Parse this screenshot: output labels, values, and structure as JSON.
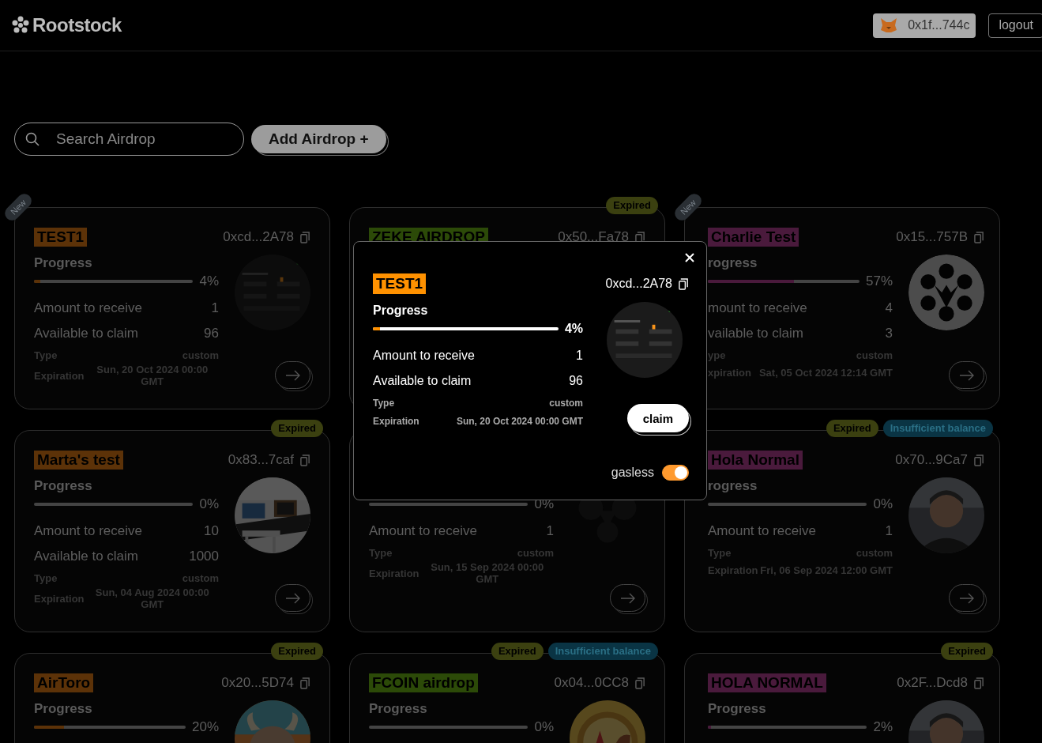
{
  "header": {
    "logo": "Rootstock",
    "wallet": "0x1f...744c",
    "logout": "logout"
  },
  "toolbar": {
    "search": {
      "placeholder": "Search Airdrop"
    },
    "add_button": "Add Airdrop +"
  },
  "cards": [
    {
      "ribbon": "New",
      "title": "TEST1",
      "color": "#5c3208",
      "address": "0xcd...2A78",
      "progress_label": "Progress",
      "level": 0.04,
      "percent": "4%",
      "rows": [
        {
          "kind": "main",
          "label": "Amount to receive",
          "value": "1"
        },
        {
          "kind": "main",
          "label": "Available to claim",
          "value": "96"
        },
        {
          "kind": "small",
          "label": "Type",
          "value": "custom"
        },
        {
          "kind": "small",
          "label": "Expiration",
          "value": "Sun, 20 Oct 2024 00:00 GMT"
        }
      ],
      "image": {
        "kind": "picture"
      },
      "open_button": true
    },
    {
      "badges": [
        {
          "text": "Expired",
          "color": "#3b4010"
        }
      ],
      "title": "ZEKE AIRDROP",
      "color": "#2c4a08",
      "address": "0x50...Fa78"
    },
    {
      "ribbon": "New",
      "title": "Charlie Test",
      "color": "#4a1a3c",
      "address": "0x15...757B",
      "progress_label": "rogress",
      "level": 0.57,
      "percent": "57%",
      "rows": [
        {
          "kind": "main",
          "label": "mount to receive",
          "value": "4"
        },
        {
          "kind": "main",
          "label": "vailable to claim",
          "value": "3"
        },
        {
          "kind": "small",
          "label": "ype",
          "value": "custom"
        },
        {
          "kind": "small",
          "label": "xpiration",
          "value": "Sat, 05 Oct 2024 12:14 GMT"
        }
      ],
      "image": {
        "kind": "logo"
      },
      "open_button": true
    },
    {
      "badges": [
        {
          "text": "Expired",
          "color": "#3b4010"
        }
      ],
      "title": "Marta's test",
      "color": "#5c3208",
      "address": "0x83...7caf",
      "progress_label": "Progress",
      "level": 0,
      "percent": "0%",
      "rows": [
        {
          "kind": "main",
          "label": "Amount to receive",
          "value": "10"
        },
        {
          "kind": "main",
          "label": "Available to claim",
          "value": "1000"
        },
        {
          "kind": "small",
          "label": "Type",
          "value": "custom"
        },
        {
          "kind": "small",
          "label": "Expiration",
          "value": "Sun, 04 Aug 2024 00:00 GMT"
        }
      ],
      "image": {
        "kind": "picture"
      },
      "open_button": true
    },
    {
      "level": 0,
      "percent": "0%",
      "rows": [
        {
          "kind": "main",
          "label": "Amount to receive",
          "value": "1"
        },
        {
          "kind": "small",
          "label": "Type",
          "value": "custom"
        },
        {
          "kind": "small",
          "label": "Expiration",
          "value": "Sun, 15 Sep 2024 00:00 GMT"
        }
      ],
      "image": {
        "kind": "mark"
      },
      "open_button": true
    },
    {
      "badges": [
        {
          "text": "Expired",
          "color": "#3b4010"
        },
        {
          "text": "Insufficient balance",
          "color": "#0a3444"
        }
      ],
      "title": "Hola Normal",
      "color": "#4a1a3c",
      "address": "0x70...9Ca7",
      "progress_label": "rogress",
      "level": 0,
      "percent": "0%",
      "rows": [
        {
          "kind": "main",
          "label": "Amount to receive",
          "value": "1"
        },
        {
          "kind": "small",
          "label": "Type",
          "value": "custom"
        },
        {
          "kind": "small",
          "label": "Expiration",
          "value": "Fri, 06 Sep 2024 12:00 GMT"
        }
      ],
      "image": {
        "kind": "picture"
      },
      "open_button": true
    },
    {
      "badges": [
        {
          "text": "Expired",
          "color": "#3b4010"
        }
      ],
      "title": "AirToro",
      "color": "#5c3208",
      "address": "0x20...5D74",
      "progress_label": "Progress",
      "level": 0.2,
      "percent": "20%",
      "image": {
        "kind": "picture"
      }
    },
    {
      "badges": [
        {
          "text": "Expired",
          "color": "#3b4010"
        },
        {
          "text": "Insufficient balance",
          "color": "#0a3444"
        }
      ],
      "title": "FCOIN airdrop",
      "color": "#2c4a08",
      "address": "0x04...0CC8",
      "progress_label": "Progress",
      "level": 0,
      "percent": "0%",
      "image": {
        "kind": "picture"
      }
    },
    {
      "badges": [
        {
          "text": "Expired",
          "color": "#3b4010"
        }
      ],
      "title": "HOLA NORMAL",
      "color": "#4a1a3c",
      "address": "0x2F...Dcd8",
      "progress_label": "Progress",
      "level": 0.02,
      "percent": "2%",
      "image": {
        "kind": "picture"
      }
    }
  ],
  "modal": {
    "title": "TEST1",
    "color": "#ff9100",
    "address": "0xcd...2A78",
    "progress_label": "Progress",
    "level": 0.04,
    "percent": "4%",
    "rows": [
      {
        "kind": "main",
        "label": "Amount to receive",
        "value": "1"
      },
      {
        "kind": "main",
        "label": "Available to claim",
        "value": "96"
      },
      {
        "kind": "small",
        "label": "Type",
        "value": "custom"
      },
      {
        "kind": "small",
        "label": "Expiration",
        "value": "Sun, 20 Oct 2024 00:00 GMT"
      }
    ],
    "image": {
      "kind": "picture"
    },
    "claim_button": "claim",
    "gasless": {
      "label": "gasless",
      "on": true
    }
  }
}
